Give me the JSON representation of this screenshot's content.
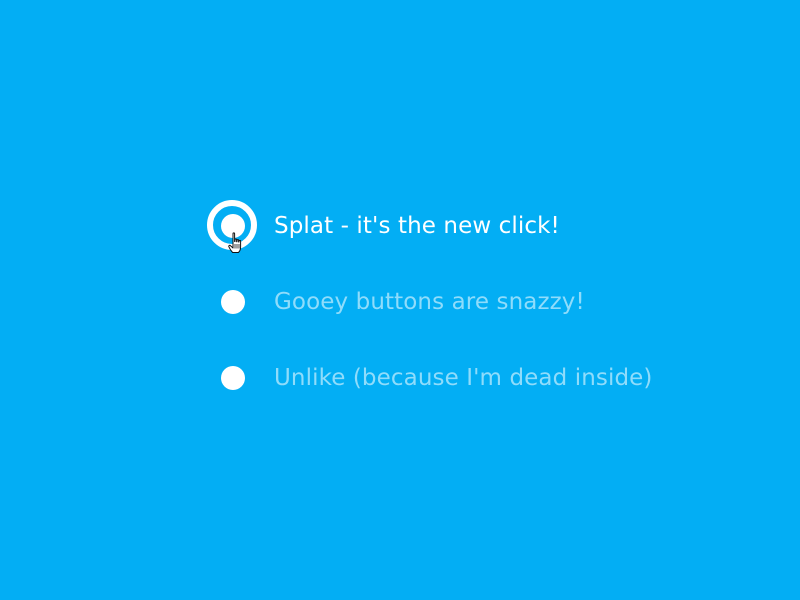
{
  "theme": {
    "background": "#03aef4",
    "active_text": "#ffffff",
    "inactive_text": "#8fdcfb",
    "radio_fill": "#ffffff"
  },
  "options": [
    {
      "label": "Splat - it's the new click!",
      "selected": true,
      "icon": "radio-selected-icon"
    },
    {
      "label": "Gooey buttons are snazzy!",
      "selected": false,
      "icon": "radio-unselected-icon"
    },
    {
      "label": "Unlike (because I'm dead inside)",
      "selected": false,
      "icon": "radio-unselected-icon"
    }
  ],
  "cursor": {
    "icon": "hand-pointer-icon"
  }
}
